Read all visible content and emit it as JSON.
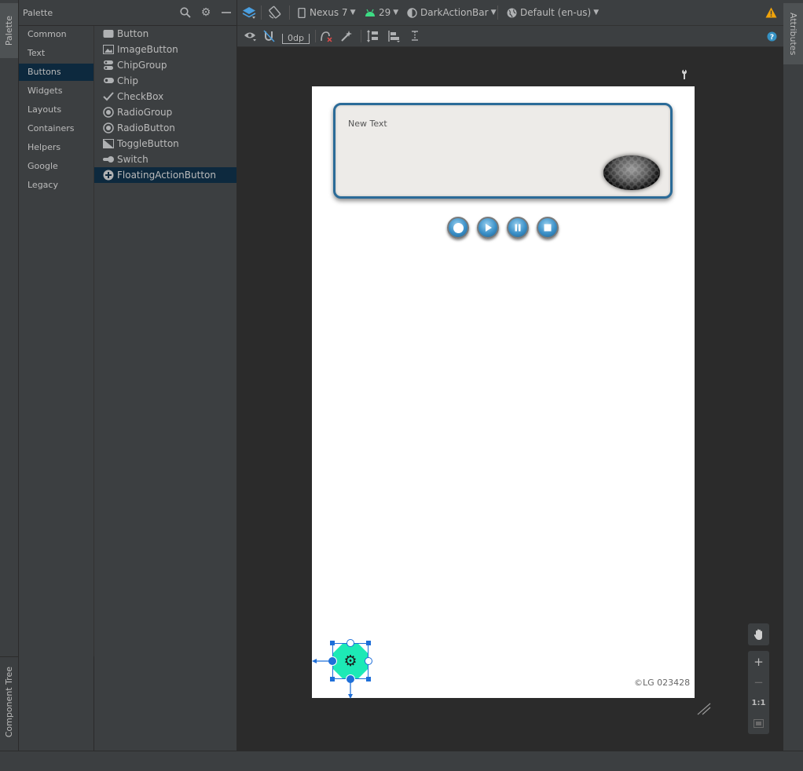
{
  "side_tabs": {
    "palette": "Palette",
    "component_tree": "Component Tree",
    "attributes": "Attributes"
  },
  "palette": {
    "title": "Palette",
    "categories": [
      "Common",
      "Text",
      "Buttons",
      "Widgets",
      "Layouts",
      "Containers",
      "Helpers",
      "Google",
      "Legacy"
    ],
    "selected_category": "Buttons",
    "items": [
      {
        "label": "Button",
        "icon": "button-icon"
      },
      {
        "label": "ImageButton",
        "icon": "image-icon"
      },
      {
        "label": "ChipGroup",
        "icon": "chipgroup-icon"
      },
      {
        "label": "Chip",
        "icon": "chip-icon"
      },
      {
        "label": "CheckBox",
        "icon": "check-icon"
      },
      {
        "label": "RadioGroup",
        "icon": "radio-icon"
      },
      {
        "label": "RadioButton",
        "icon": "radio-icon"
      },
      {
        "label": "ToggleButton",
        "icon": "toggle-icon"
      },
      {
        "label": "Switch",
        "icon": "switch-icon"
      },
      {
        "label": "FloatingActionButton",
        "icon": "plus-circle-icon"
      }
    ],
    "selected_item": "FloatingActionButton"
  },
  "toolbar": {
    "device": "Nexus 7",
    "api": "29",
    "theme": "DarkActionBar",
    "locale": "Default (en-us)",
    "margin": "0dp"
  },
  "design": {
    "card_text": "New Text",
    "copyright": "©LG 023428",
    "media_buttons": [
      "record",
      "play",
      "pause",
      "stop"
    ]
  },
  "zoom": {
    "plus": "+",
    "minus": "−",
    "one_to_one": "1:1"
  },
  "colors": {
    "accent": "#1e6fd9",
    "fab": "#1de9b6",
    "card_border": "#2b6b98",
    "warning": "#f0a30a"
  }
}
